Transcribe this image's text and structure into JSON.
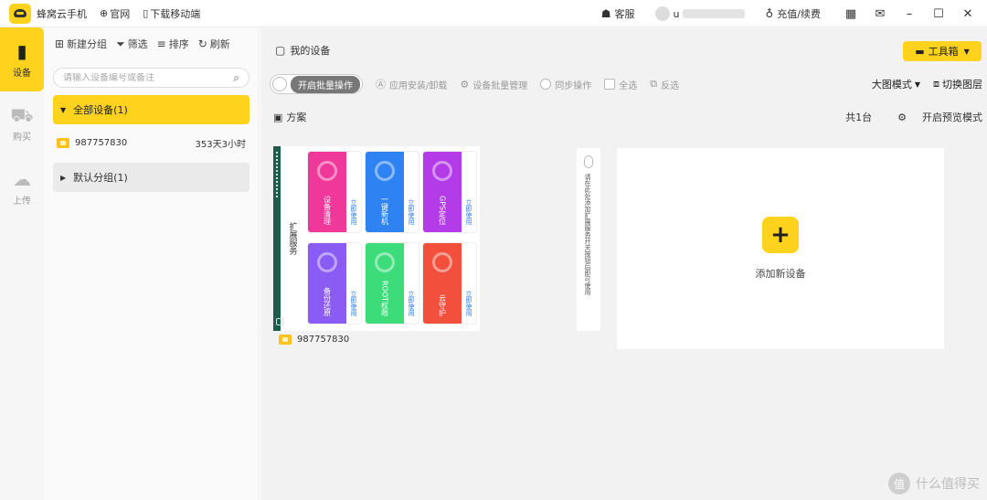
{
  "titlebar": {
    "app_name": "蜂窝云手机",
    "official_site": "官网",
    "download_mobile": "下载移动端",
    "customer_service": "客服",
    "user_prefix": "u",
    "recharge": "充值/续费"
  },
  "leftnav": {
    "items": [
      {
        "label": "设备",
        "icon": "device-icon"
      },
      {
        "label": "购买",
        "icon": "cart-icon"
      },
      {
        "label": "上传",
        "icon": "upload-icon"
      }
    ]
  },
  "groups": {
    "toolbar": {
      "new_group": "新建分组",
      "filter": "筛选",
      "sort": "排序",
      "refresh": "刷新"
    },
    "search_placeholder": "请输入设备编号或备注",
    "all_devices": "全部设备(1)",
    "device": {
      "id": "987757830",
      "remaining": "353天3小时"
    },
    "default_group": "默认分组(1)"
  },
  "main": {
    "title": "我的设备",
    "toolbox": "工具箱",
    "actions": {
      "batch_toggle": "开启批量操作",
      "install_uninstall": "应用安装/卸载",
      "batch_manage": "设备批量管理",
      "sync": "同步操作",
      "select_all": "全选",
      "invert": "反选",
      "view_mode": "大图模式",
      "switch_layer": "切换图层"
    },
    "sub": {
      "solution": "方案",
      "total": "共1台",
      "preview_mode": "开启预览模式"
    },
    "phone": {
      "screen_title": "扩展服务",
      "tiles": [
        {
          "name": "设备清理",
          "side": "立即使用",
          "color": "#f0389a"
        },
        {
          "name": "一键新机",
          "side": "立即使用",
          "color": "#2f82f2"
        },
        {
          "name": "GPS定位",
          "side": "立即使用",
          "color": "#b43ce8"
        },
        {
          "name": "备份还原",
          "side": "立即使用",
          "color": "#8a5cf4"
        },
        {
          "name": "ROOT权限",
          "side": "立即使用",
          "color": "#3ddc7a"
        },
        {
          "name": "云守护",
          "side": "立即使用",
          "color": "#f2503c"
        }
      ]
    },
    "device_name": "987757830",
    "banner_text": "请在此处添加扩展服务开关按钮后即可使用",
    "add_device": "添加新设备"
  },
  "watermark": {
    "badge": "值",
    "text": "什么值得买"
  },
  "colors": {
    "accent": "#ffd21e",
    "statusbar": "#1b5e4e"
  }
}
